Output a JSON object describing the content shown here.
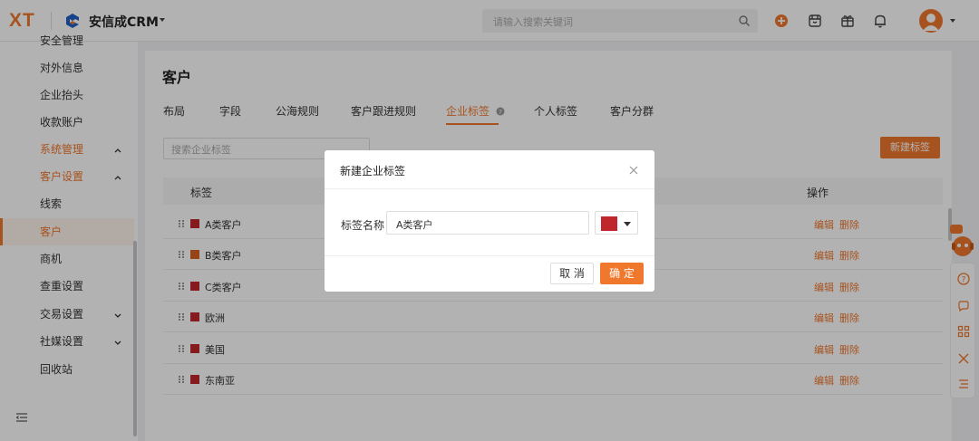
{
  "topbar": {
    "logo": "XT",
    "app_name": "安信成CRM",
    "search_placeholder": "请输入搜索关键词",
    "icons": [
      "search-icon",
      "add-circle-icon",
      "store-icon",
      "gift-icon",
      "bell-icon",
      "avatar",
      "chevron-down-icon"
    ]
  },
  "sidebar": {
    "items": [
      {
        "label": "安全管理"
      },
      {
        "label": "对外信息"
      },
      {
        "label": "企业抬头"
      },
      {
        "label": "收款账户"
      },
      {
        "label": "系统管理",
        "expanded": true
      },
      {
        "label": "客户设置",
        "expanded": true
      },
      {
        "label": "线索"
      },
      {
        "label": "客户",
        "active": true
      },
      {
        "label": "商机"
      },
      {
        "label": "查重设置"
      },
      {
        "label": "交易设置",
        "expanded": false
      },
      {
        "label": "社媒设置",
        "expanded": false
      },
      {
        "label": "回收站"
      }
    ]
  },
  "main": {
    "title": "客户",
    "tabs": [
      {
        "label": "布局"
      },
      {
        "label": "字段"
      },
      {
        "label": "公海规则"
      },
      {
        "label": "客户跟进规则"
      },
      {
        "label": "企业标签",
        "active": true
      },
      {
        "label": "个人标签"
      },
      {
        "label": "客户分群"
      }
    ],
    "filter_placeholder": "搜索企业标签",
    "new_button": "新建标签",
    "table": {
      "headers": {
        "label": "标签",
        "ops": "操作"
      },
      "rows": [
        {
          "name": "A类客户",
          "color": "#c0272d"
        },
        {
          "name": "B类客户",
          "color": "#d4621f"
        },
        {
          "name": "C类客户",
          "color": "#c0272d"
        },
        {
          "name": "欧洲",
          "color": "#c0272d"
        },
        {
          "name": "美国",
          "color": "#c0272d"
        },
        {
          "name": "东南亚",
          "color": "#c0272d"
        }
      ],
      "edit_label": "编辑",
      "delete_label": "删除"
    }
  },
  "modal": {
    "title": "新建企业标签",
    "field_label": "标签名称",
    "field_value": "A类客户",
    "selected_color": "#c0272d",
    "cancel": "取 消",
    "ok": "确 定"
  },
  "colors": {
    "accent": "#f0782d"
  }
}
